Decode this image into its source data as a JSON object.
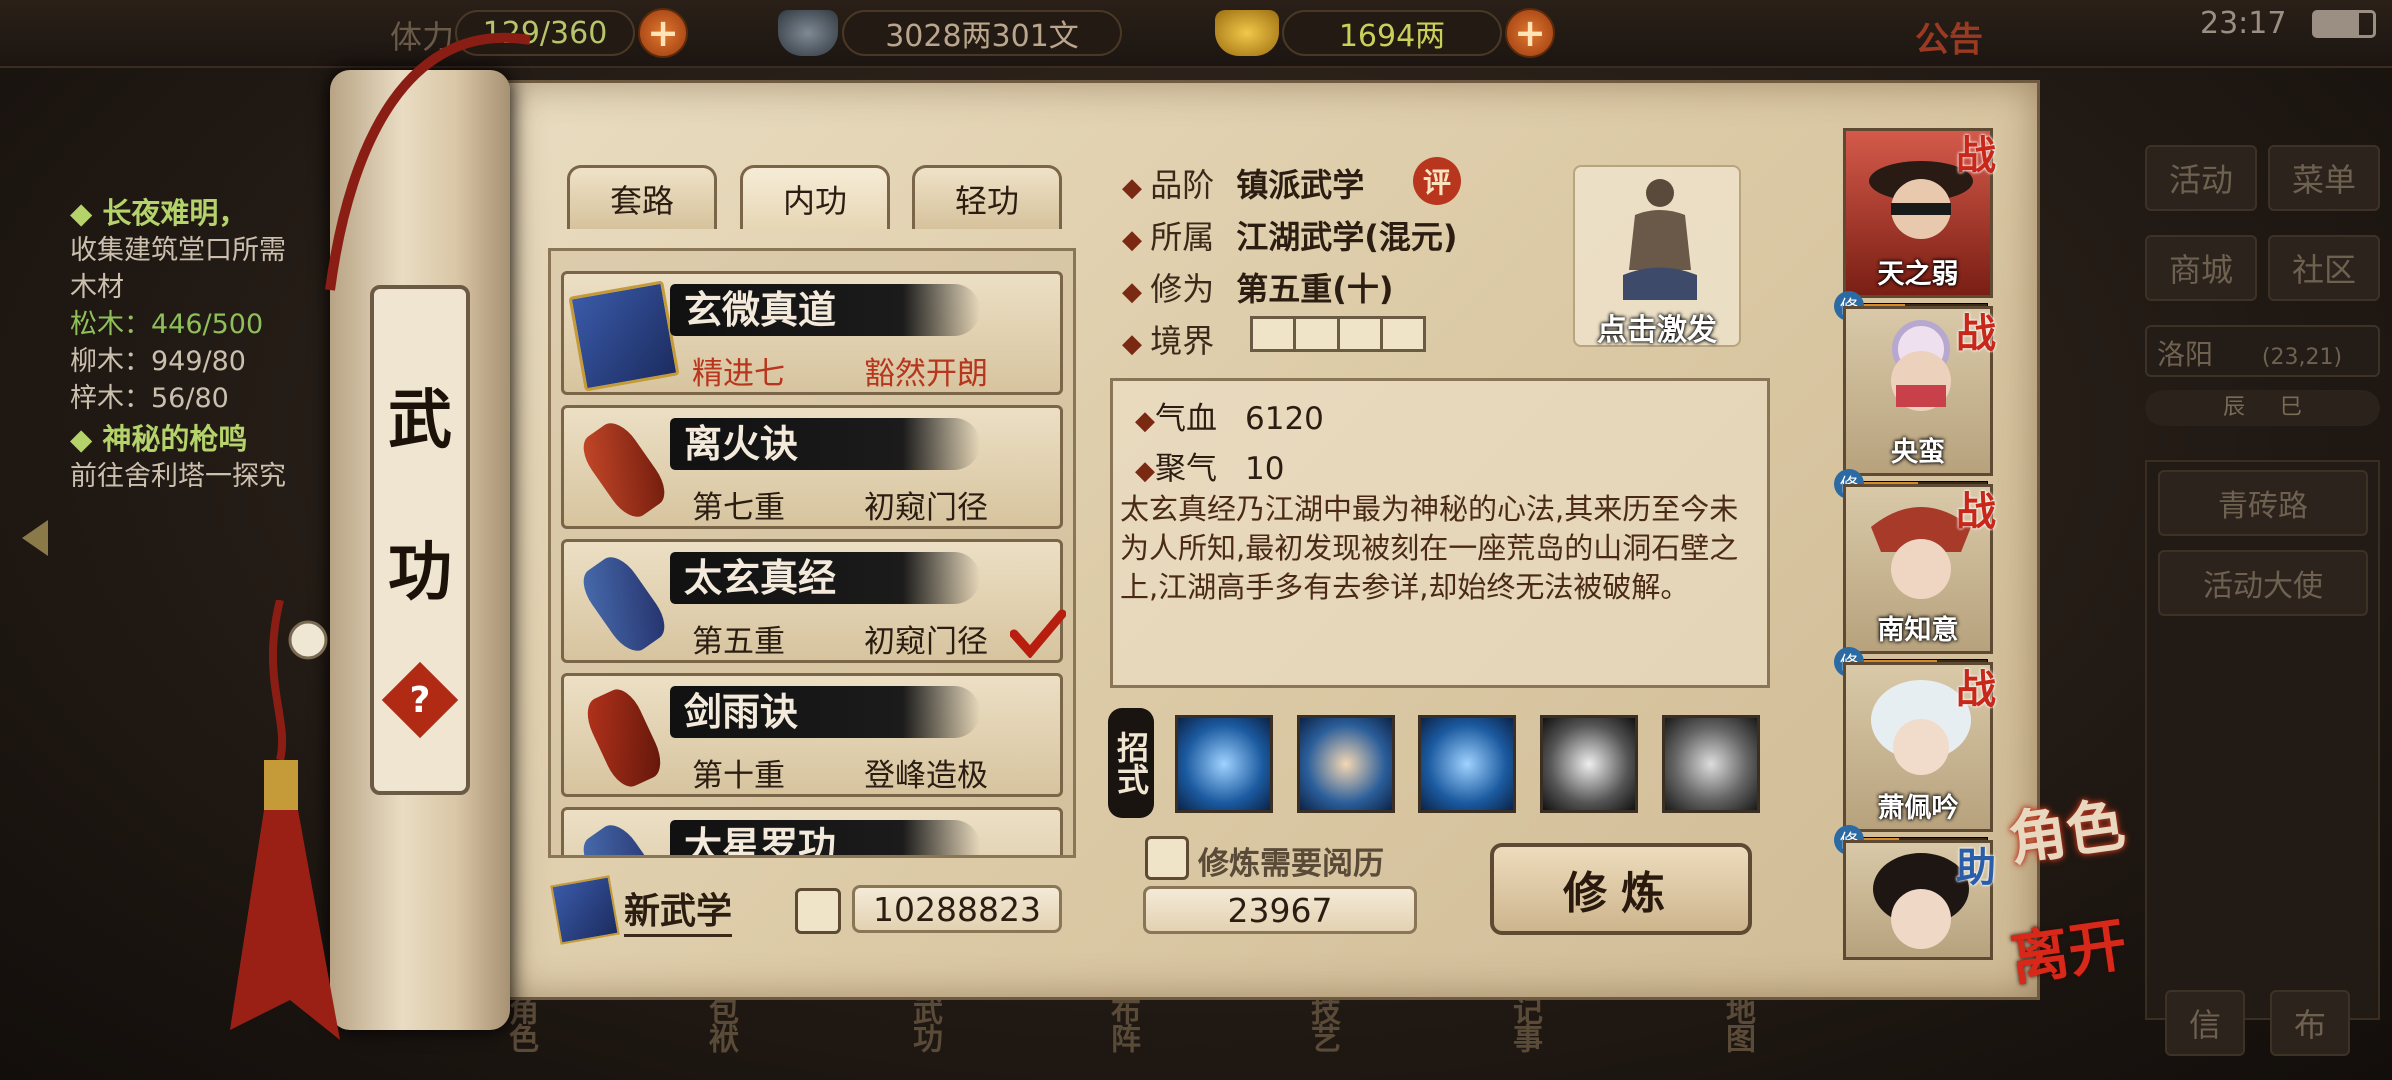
{
  "statusbar": {
    "time": "23:17"
  },
  "resources": {
    "stamina": "129/360",
    "stamina_label": "体力",
    "silver": "3028两301文",
    "gold": "1694两",
    "notice": "公告"
  },
  "left_quests": {
    "quest1_title": "◆ 长夜难明，",
    "quest1_desc": "收集建筑堂口所需",
    "quest1_sub": "木材",
    "items": [
      "松木：446/500",
      "柳木：949/80",
      "梓木：56/80"
    ],
    "quest2_title": "◆ 神秘的枪鸣",
    "quest2_desc": "前往舍利塔一探究"
  },
  "right_menu": {
    "buttons": [
      "活动",
      "菜单",
      "商城",
      "社区"
    ],
    "location": "洛阳",
    "coords": "(23,21)",
    "time_slots": [
      "辰",
      "巳"
    ],
    "road": "青砖路",
    "ambassador": "活动大使",
    "bottom": [
      "信",
      "布"
    ]
  },
  "scroll": {
    "title_chars": [
      "武",
      "功"
    ],
    "help": "?"
  },
  "tabs": [
    "套路",
    "内功",
    "轻功"
  ],
  "martial_list": [
    {
      "name": "玄微真道",
      "level": "精进七",
      "state": "豁然开朗",
      "highlight": true
    },
    {
      "name": "离火诀",
      "level": "第七重",
      "state": "初窥门径",
      "highlight": false
    },
    {
      "name": "太玄真经",
      "level": "第五重",
      "state": "初窥门径",
      "highlight": false,
      "checked": true
    },
    {
      "name": "剑雨诀",
      "level": "第十重",
      "state": "登峰造极",
      "highlight": false
    },
    {
      "name": "大星罗功",
      "level": "",
      "state": "",
      "highlight": false
    }
  ],
  "new_martial": "新武学",
  "book_points": "10288823",
  "detail": {
    "rank_label": "品阶",
    "rank_value": "镇派武学",
    "rank_badge": "评",
    "belong_label": "所属",
    "belong_value": "江湖武学(混元)",
    "cultivation_label": "修为",
    "cultivation_value": "第五重(十)",
    "realm_label": "境界",
    "activate": "点击激发",
    "qixue_label": "气血",
    "qixue_value": "6120",
    "juqi_label": "聚气",
    "juqi_value": "10",
    "description": "太玄真经乃江湖中最为神秘的心法,其来历至今未为人所知,最初发现被刻在一座荒岛的山洞石壁之上,江湖高手多有去参详,却始终无法被破解。",
    "moves_label": "招式",
    "require_label": "修炼需要阅历",
    "require_value": "23967",
    "train_button": "修炼"
  },
  "characters": [
    {
      "name": "天之弱",
      "tag": "战",
      "progress": 0.35
    },
    {
      "name": "央蛮",
      "tag": "战",
      "progress": 0.45
    },
    {
      "name": "南知意",
      "tag": "战",
      "progress": 0.6
    },
    {
      "name": "萧佩吟",
      "tag": "战",
      "progress": 0.3
    },
    {
      "name": "",
      "tag": "助"
    }
  ],
  "side_labels": {
    "role": "角色",
    "leave": "离开",
    "xiu": "修"
  },
  "bottom_nav": [
    "角色",
    "包袱",
    "武功",
    "布阵",
    "技艺",
    "记事",
    "地图"
  ],
  "colors": {
    "accent_red": "#b8361e",
    "parchment": "#e3d2b2",
    "ink": "#2b1d12"
  }
}
